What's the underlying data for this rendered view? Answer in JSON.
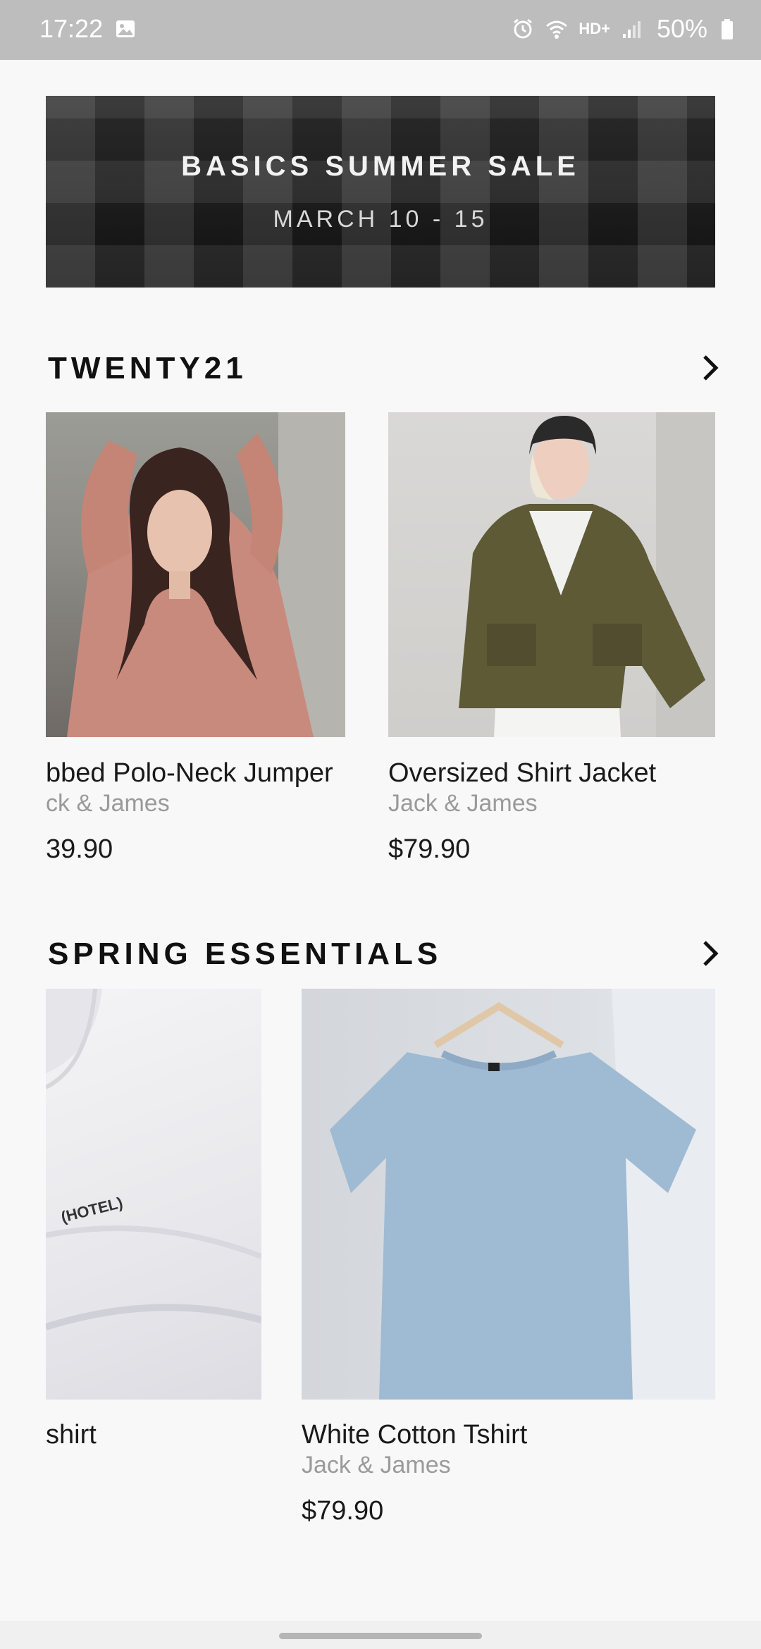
{
  "status_bar": {
    "time": "17:22",
    "network_label": "HD+",
    "battery": "50%"
  },
  "banner": {
    "title": "BASICS SUMMER SALE",
    "subtitle": "MARCH 10 - 15"
  },
  "sections": [
    {
      "title": "TWENTY21",
      "products": [
        {
          "name": "bbed Polo-Neck Jumper",
          "brand": "ck & James",
          "price": "39.90"
        },
        {
          "name": "Oversized Shirt Jacket",
          "brand": "Jack & James",
          "price": "$79.90"
        }
      ]
    },
    {
      "title": "SPRING ESSENTIALS",
      "products": [
        {
          "name": "shirt"
        },
        {
          "name": "White Cotton Tshirt",
          "brand": "Jack & James",
          "price": "$79.90"
        }
      ]
    }
  ],
  "image_print": "(HOTEL)",
  "colors": {
    "background": "#f8f8f8",
    "status_bar": "#bdbdbd",
    "brand_text": "#9a9a9a",
    "primary_text": "#1a1a1a"
  }
}
